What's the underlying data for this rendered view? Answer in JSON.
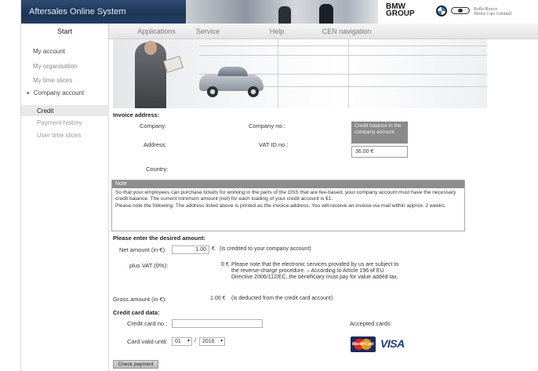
{
  "app": {
    "title": "Aftersales Online System"
  },
  "brand": {
    "group_line1": "BMW",
    "group_line2": "GROUP",
    "rr_line1": "Rolls-Royce",
    "rr_line2": "Motor Cars Limited"
  },
  "nav": {
    "tabs": [
      "Start",
      "Applications",
      "Service",
      "Help",
      "CEN navigation"
    ]
  },
  "sidebar": {
    "items": [
      {
        "label": "My account"
      },
      {
        "label": "My organisation"
      },
      {
        "label": "My time slices"
      },
      {
        "label": "Company account"
      },
      {
        "label": "Credit"
      },
      {
        "label": "Payment history"
      },
      {
        "label": "User time slices"
      }
    ],
    "expand_glyph": "▾"
  },
  "invoice": {
    "heading": "Invoice address:",
    "company_label": "Company:",
    "company_no_label": "Company no.:",
    "address_label": "Address:",
    "vat_label": "VAT ID no.:",
    "country_label": "Country:",
    "credit_title": "Credit balance in the company account",
    "credit_value": "36.00 €"
  },
  "note": {
    "heading": "Note",
    "line1": "So that your employees can purchase tickets for working in the parts of the OSS that are fee-based, your company account must have the necessary credit balance. The current minimum amount (net) for each loading of your credit account is €1.",
    "line2": "Please note the following: The address listed above is printed as the invoice address. You will receive an invoice via mail within approx. 2 weeks."
  },
  "amount": {
    "heading": "Please enter the desired amount:",
    "net_label": "Net amount (in €):",
    "net_value": "1.00",
    "net_currency": "€",
    "net_note": "(is credited to your company account)",
    "vat_label": "plus VAT (0%):",
    "vat_value": "0 €",
    "vat_note": "Please note that the electronic services provided by us are subject to the reverse-charge procedure. – According to Article 196 of EU Directive 2006/112/EC, the beneficiary must pay for value added tax.",
    "gross_label": "Gross amount (in €):",
    "gross_value": "1.00 €",
    "gross_note": "(is deducted from the credit card account)"
  },
  "card": {
    "heading": "Credit card data:",
    "number_label": "Credit card no.:",
    "number_value": "",
    "valid_label": "Card valid until:",
    "month": "01",
    "separator": "/",
    "year": "2016",
    "accepted_label": "Accepted cards:",
    "mastercard_text": "MasterCard",
    "visa_text": "VISA"
  },
  "actions": {
    "check_payment": "Check payment"
  }
}
